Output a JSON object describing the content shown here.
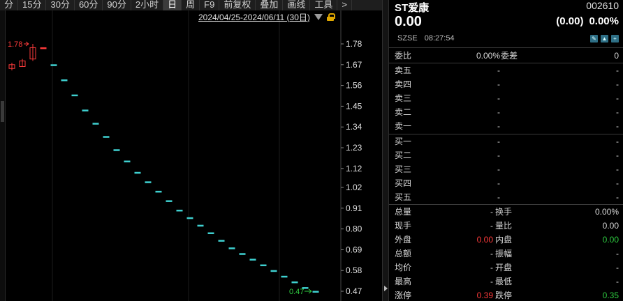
{
  "toolbar": {
    "items": [
      "分",
      "15分",
      "30分",
      "60分",
      "90分",
      "2小时",
      "日",
      "周",
      "F9",
      "前复权",
      "叠加",
      "画线",
      "工具",
      ">"
    ],
    "active_index": 6
  },
  "range": {
    "text": "2024/04/25-2024/06/11 (30日)"
  },
  "colors": {
    "up": "#ff3b3b",
    "down": "#2ecc40",
    "tick": "#3fd0d0",
    "bg": "#000000"
  },
  "chart_data": {
    "type": "candlestick",
    "y_ticks": [
      "1.78",
      "1.67",
      "1.56",
      "1.45",
      "1.34",
      "1.23",
      "1.12",
      "1.02",
      "0.91",
      "0.80",
      "0.69",
      "0.58",
      "0.47"
    ],
    "ylim": [
      0.47,
      1.78
    ],
    "high_label": "1.78",
    "low_label": "0.47",
    "candles": [
      {
        "o": 1.65,
        "c": 1.67,
        "h": 1.68,
        "l": 1.64,
        "color": "up"
      },
      {
        "o": 1.66,
        "c": 1.69,
        "h": 1.7,
        "l": 1.66,
        "color": "up"
      },
      {
        "o": 1.7,
        "c": 1.76,
        "h": 1.78,
        "l": 1.69,
        "color": "up"
      },
      {
        "o": 1.76,
        "c": 1.76,
        "h": 1.76,
        "l": 1.76,
        "color": "up"
      },
      {
        "o": 1.67,
        "c": 1.67,
        "h": 1.67,
        "l": 1.67,
        "color": "down"
      },
      {
        "o": 1.59,
        "c": 1.59,
        "h": 1.59,
        "l": 1.59,
        "color": "down"
      },
      {
        "o": 1.51,
        "c": 1.51,
        "h": 1.51,
        "l": 1.51,
        "color": "down"
      },
      {
        "o": 1.43,
        "c": 1.43,
        "h": 1.43,
        "l": 1.43,
        "color": "down"
      },
      {
        "o": 1.36,
        "c": 1.36,
        "h": 1.36,
        "l": 1.36,
        "color": "down"
      },
      {
        "o": 1.29,
        "c": 1.29,
        "h": 1.29,
        "l": 1.29,
        "color": "down"
      },
      {
        "o": 1.22,
        "c": 1.22,
        "h": 1.22,
        "l": 1.22,
        "color": "down"
      },
      {
        "o": 1.16,
        "c": 1.16,
        "h": 1.16,
        "l": 1.16,
        "color": "down"
      },
      {
        "o": 1.1,
        "c": 1.1,
        "h": 1.1,
        "l": 1.1,
        "color": "down"
      },
      {
        "o": 1.05,
        "c": 1.05,
        "h": 1.05,
        "l": 1.05,
        "color": "down"
      },
      {
        "o": 1.0,
        "c": 1.0,
        "h": 1.0,
        "l": 1.0,
        "color": "down"
      },
      {
        "o": 0.95,
        "c": 0.95,
        "h": 0.95,
        "l": 0.95,
        "color": "down"
      },
      {
        "o": 0.9,
        "c": 0.9,
        "h": 0.9,
        "l": 0.9,
        "color": "down"
      },
      {
        "o": 0.86,
        "c": 0.86,
        "h": 0.86,
        "l": 0.86,
        "color": "down"
      },
      {
        "o": 0.82,
        "c": 0.82,
        "h": 0.82,
        "l": 0.82,
        "color": "down"
      },
      {
        "o": 0.78,
        "c": 0.78,
        "h": 0.78,
        "l": 0.78,
        "color": "down"
      },
      {
        "o": 0.74,
        "c": 0.74,
        "h": 0.74,
        "l": 0.74,
        "color": "down"
      },
      {
        "o": 0.7,
        "c": 0.7,
        "h": 0.7,
        "l": 0.7,
        "color": "down"
      },
      {
        "o": 0.67,
        "c": 0.67,
        "h": 0.67,
        "l": 0.67,
        "color": "down"
      },
      {
        "o": 0.64,
        "c": 0.64,
        "h": 0.64,
        "l": 0.64,
        "color": "down"
      },
      {
        "o": 0.61,
        "c": 0.61,
        "h": 0.61,
        "l": 0.61,
        "color": "down"
      },
      {
        "o": 0.58,
        "c": 0.58,
        "h": 0.58,
        "l": 0.58,
        "color": "down"
      },
      {
        "o": 0.55,
        "c": 0.55,
        "h": 0.55,
        "l": 0.55,
        "color": "down"
      },
      {
        "o": 0.52,
        "c": 0.52,
        "h": 0.52,
        "l": 0.52,
        "color": "down"
      },
      {
        "o": 0.49,
        "c": 0.49,
        "h": 0.49,
        "l": 0.49,
        "color": "down"
      },
      {
        "o": 0.47,
        "c": 0.47,
        "h": 0.47,
        "l": 0.47,
        "color": "down"
      }
    ]
  },
  "quote": {
    "name": "ST爱康",
    "code": "002610",
    "price": "0.00",
    "change": "(0.00)",
    "change_pct": "0.00%",
    "exchange": "SZSE",
    "time": "08:27:54",
    "icons": [
      "edit-icon",
      "bell-icon",
      "add-icon"
    ]
  },
  "orderbook": {
    "weibi_label": "委比",
    "weibi_value": "0.00%",
    "weicha_label": "委差",
    "weicha_value": "0",
    "sells": [
      {
        "label": "卖五",
        "price": "-",
        "vol": "-"
      },
      {
        "label": "卖四",
        "price": "-",
        "vol": "-"
      },
      {
        "label": "卖三",
        "price": "-",
        "vol": "-"
      },
      {
        "label": "卖二",
        "price": "-",
        "vol": "-"
      },
      {
        "label": "卖一",
        "price": "-",
        "vol": "-"
      }
    ],
    "buys": [
      {
        "label": "买一",
        "price": "-",
        "vol": "-"
      },
      {
        "label": "买二",
        "price": "-",
        "vol": "-"
      },
      {
        "label": "买三",
        "price": "-",
        "vol": "-"
      },
      {
        "label": "买四",
        "price": "-",
        "vol": "-"
      },
      {
        "label": "买五",
        "price": "-",
        "vol": "-"
      }
    ]
  },
  "stats": [
    {
      "l1": "总量",
      "v1": "-",
      "l2": "换手",
      "v2": "0.00%",
      "c1": "",
      "c2": ""
    },
    {
      "l1": "现手",
      "v1": "-",
      "l2": "量比",
      "v2": "0.00",
      "c1": "",
      "c2": ""
    },
    {
      "l1": "外盘",
      "v1": "0.00",
      "l2": "内盘",
      "v2": "0.00",
      "c1": "red",
      "c2": "green"
    },
    {
      "l1": "总额",
      "v1": "-",
      "l2": "振幅",
      "v2": "-",
      "c1": "",
      "c2": ""
    },
    {
      "l1": "均价",
      "v1": "-",
      "l2": "开盘",
      "v2": "-",
      "c1": "",
      "c2": ""
    },
    {
      "l1": "最高",
      "v1": "-",
      "l2": "最低",
      "v2": "-",
      "c1": "",
      "c2": ""
    },
    {
      "l1": "涨停",
      "v1": "0.39",
      "l2": "跌停",
      "v2": "0.35",
      "c1": "red",
      "c2": "green"
    }
  ]
}
